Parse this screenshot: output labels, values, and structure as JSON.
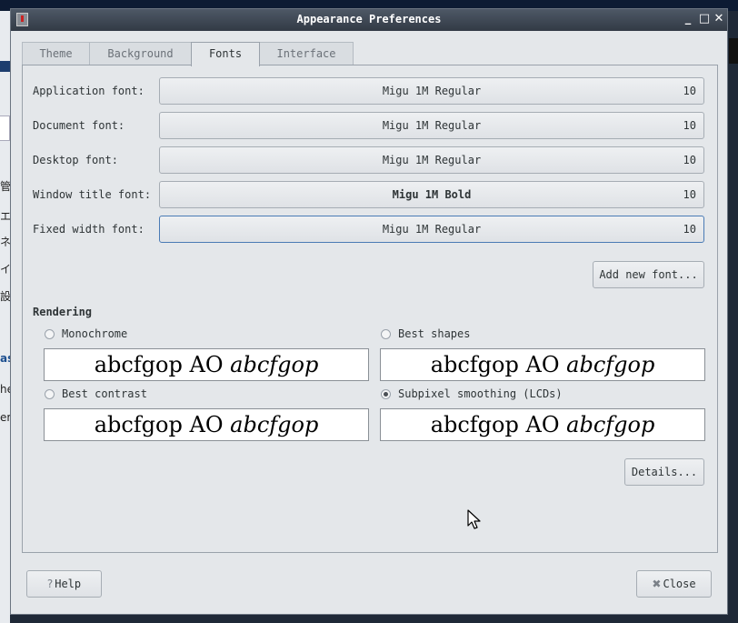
{
  "window": {
    "title": "Appearance Preferences"
  },
  "tabs": [
    {
      "label": "Theme"
    },
    {
      "label": "Background"
    },
    {
      "label": "Fonts"
    },
    {
      "label": "Interface"
    }
  ],
  "fonts": {
    "rows": [
      {
        "label": "Application font:",
        "font": "Migu 1M Regular",
        "size": "10"
      },
      {
        "label": "Document font:",
        "font": "Migu 1M Regular",
        "size": "10"
      },
      {
        "label": "Desktop font:",
        "font": "Migu 1M Regular",
        "size": "10"
      },
      {
        "label": "Window title font:",
        "font": "Migu 1M Bold",
        "size": "10"
      },
      {
        "label": "Fixed width font:",
        "font": "Migu 1M Regular",
        "size": "10"
      }
    ],
    "add_button": "Add new font..."
  },
  "rendering": {
    "heading": "Rendering",
    "options": [
      {
        "label": "Monochrome",
        "selected": false,
        "preview_regular": "abcfgop AO",
        "preview_italic": "abcfgop"
      },
      {
        "label": "Best shapes",
        "selected": false,
        "preview_regular": "abcfgop AO",
        "preview_italic": "abcfgop"
      },
      {
        "label": "Best contrast",
        "selected": false,
        "preview_regular": "abcfgop AO",
        "preview_italic": "abcfgop"
      },
      {
        "label": "Subpixel smoothing (LCDs)",
        "selected": true,
        "preview_regular": "abcfgop AO",
        "preview_italic": "abcfgop"
      }
    ],
    "details_button": "Details..."
  },
  "footer": {
    "help_label": "Help",
    "close_label": "Close"
  },
  "background_window_fragments": [
    "管",
    "エ",
    "ネ",
    "イ",
    "設",
    "as",
    "he",
    "er"
  ]
}
